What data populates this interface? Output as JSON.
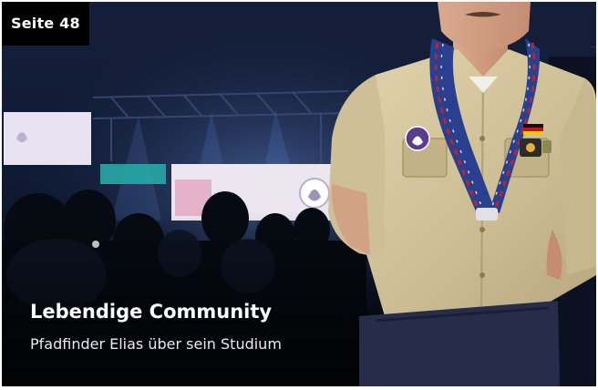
{
  "badge": {
    "label": "Seite 48"
  },
  "teaser": {
    "headline": "Lebendige Community",
    "subline": "Pfadfinder Elias über sein Studium"
  },
  "colors": {
    "badge_bg": "#000000",
    "text": "#ffffff",
    "hall_backdrop": "#0c1526",
    "uniform": "#d4c49d",
    "scarf_blue": "#2b3f8f",
    "scarf_red": "#b8262f",
    "stage_light": "#e7e3f0"
  },
  "icons": {
    "scout_emblem": "fleur-de-lis-icon",
    "flag": "german-flag-icon"
  }
}
